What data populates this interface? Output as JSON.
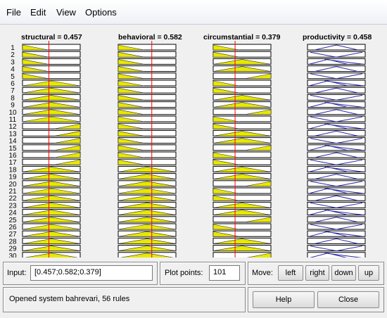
{
  "menu": {
    "file": "File",
    "edit": "Edit",
    "view": "View",
    "options": "Options"
  },
  "inputs_header": [
    {
      "name": "structural",
      "value": "0.457",
      "text": "structural = 0.457"
    },
    {
      "name": "behavioral",
      "value": "0.582",
      "text": "behavioral = 0.582"
    },
    {
      "name": "circumstantial",
      "value": "0.379",
      "text": "circumstantial = 0.379"
    }
  ],
  "output_header": {
    "name": "productivity",
    "value": "0.458",
    "text": "productivity = 0.458"
  },
  "rule_numbers": [
    "1",
    "2",
    "3",
    "4",
    "5",
    "6",
    "7",
    "8",
    "9",
    "10",
    "11",
    "12",
    "13",
    "14",
    "15",
    "16",
    "17",
    "18",
    "19",
    "20",
    "21",
    "22",
    "23",
    "24",
    "25",
    "26",
    "27",
    "28",
    "29",
    "30"
  ],
  "colors": {
    "fill": "#e8e800",
    "output_line": "#2a2aa8",
    "marker": "#ff0000",
    "fill_edge": "#333333"
  },
  "bottom": {
    "input_label": "Input:",
    "input_value": "[0.457;0.582;0.379]",
    "plot_points_label": "Plot points:",
    "plot_points_value": "101",
    "move_label": "Move:",
    "left_button": "left",
    "right_button": "right",
    "down_button": "down",
    "up_button": "up",
    "status": "Opened system bahrevari, 56 rules",
    "help_button": "Help",
    "close_button": "Close"
  }
}
